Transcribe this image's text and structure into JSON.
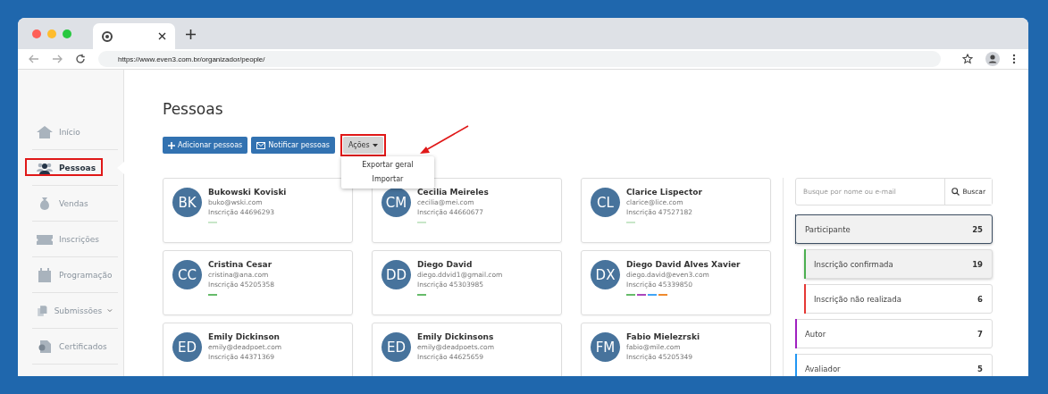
{
  "browser": {
    "address": "https://www.even3.com.br/organizador/people/"
  },
  "sidebar": {
    "items": [
      {
        "label": "Início",
        "kind": "home",
        "selected": false,
        "highlighted": false,
        "expandable": false
      },
      {
        "label": "Pessoas",
        "kind": "people",
        "selected": true,
        "highlighted": true,
        "expandable": false
      },
      {
        "label": "Vendas",
        "kind": "money",
        "selected": false,
        "highlighted": false,
        "expandable": false
      },
      {
        "label": "Inscrições",
        "kind": "ticket",
        "selected": false,
        "highlighted": false,
        "expandable": false
      },
      {
        "label": "Programação",
        "kind": "calendar",
        "selected": false,
        "highlighted": false,
        "expandable": false
      },
      {
        "label": "Submissões",
        "kind": "document",
        "selected": false,
        "highlighted": false,
        "expandable": true
      },
      {
        "label": "Certificados",
        "kind": "certificate",
        "selected": false,
        "highlighted": false,
        "expandable": false
      }
    ]
  },
  "page": {
    "title": "Pessoas"
  },
  "toolbar": {
    "buttons": [
      {
        "label": "Adicionar pessoas",
        "kind": "plus",
        "highlighted": false
      },
      {
        "label": "Notificar pessoas",
        "kind": "mail",
        "highlighted": false
      },
      {
        "label": "Ações",
        "kind": "dropdown",
        "highlighted": true,
        "expanded": true
      }
    ],
    "menu": [
      "Exportar geral",
      "Importar"
    ]
  },
  "people": [
    {
      "initials": "BK",
      "name": "Bukowski Koviski",
      "email": "buko@wski.com",
      "registration": "Inscrição 44696293",
      "tags": [
        {
          "color": "#c8e6c9"
        }
      ]
    },
    {
      "initials": "CM",
      "name": "Cecilia Meireles",
      "email": "cecilia@mei.com",
      "registration": "Inscrição 44660677",
      "tags": [
        {
          "color": "#c8e6c9"
        }
      ]
    },
    {
      "initials": "CL",
      "name": "Clarice Lispector",
      "email": "clarice@lice.com",
      "registration": "Inscrição 47527182",
      "tags": [
        {
          "color": "#c8e6c9"
        }
      ]
    },
    {
      "initials": "CC",
      "name": "Cristina Cesar",
      "email": "cristina@ana.com",
      "registration": "Inscrição 45205358",
      "tags": [
        {
          "color": "#66bb6a"
        }
      ]
    },
    {
      "initials": "DD",
      "name": "Diego David",
      "email": "diego.ddvid1@gmail.com",
      "registration": "Inscrição 45303985",
      "tags": [
        {
          "color": "#66bb6a"
        }
      ]
    },
    {
      "initials": "DX",
      "name": "Diego David Alves Xavier",
      "email": "diego.david@even3.com",
      "registration": "Inscrição 45339850",
      "tags": [
        {
          "color": "#66bb6a"
        },
        {
          "color": "#ab47bc"
        },
        {
          "color": "#42a5f5"
        },
        {
          "color": "#ef8a2e"
        }
      ]
    },
    {
      "initials": "ED",
      "name": "Emily Dickinson",
      "email": "emily@deadpoet.com",
      "registration": "Inscrição 44371369"
    },
    {
      "initials": "ED",
      "name": "Emily Dickinsons",
      "email": "emily@deadpoets.com",
      "registration": "Inscrição 44625659"
    },
    {
      "initials": "FM",
      "name": "Fabio Mielezrski",
      "email": "fabio@mile.com",
      "registration": "Inscrição 45205349"
    }
  ],
  "search": {
    "placeholder": "Busque por nome ou e-mail",
    "button": "Buscar"
  },
  "filters": [
    {
      "label": "Participante",
      "count": "25",
      "selected": true,
      "color": "#3d4f63",
      "children": [
        {
          "label": "Inscrição confirmada",
          "count": "19",
          "selected": true,
          "color": "#4caf50"
        },
        {
          "label": "Inscrição não realizada",
          "count": "6",
          "selected": false,
          "color": "#e53935"
        }
      ]
    },
    {
      "label": "Autor",
      "count": "7",
      "selected": false,
      "color": "#a020c0"
    },
    {
      "label": "Avaliador",
      "count": "5",
      "selected": false,
      "color": "#2196f3"
    }
  ]
}
